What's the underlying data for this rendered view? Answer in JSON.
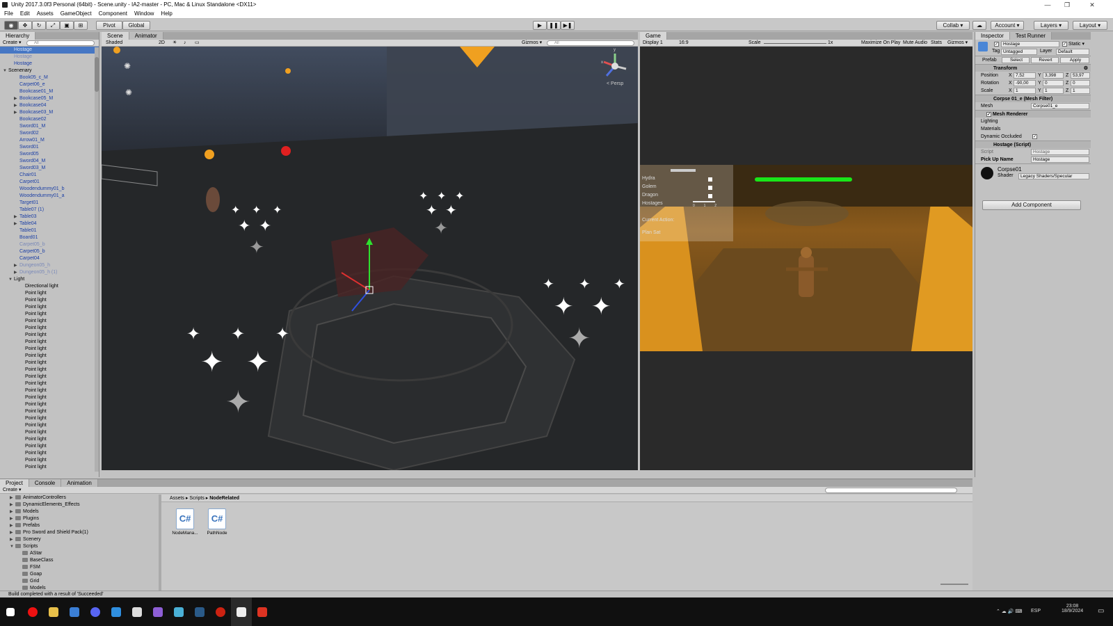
{
  "window": {
    "title": "Unity 2017.3.0f3 Personal (64bit) - Scene.unity - IA2-master - PC, Mac & Linux Standalone <DX11>",
    "minimize": "—",
    "maximize": "❐",
    "close": "✕"
  },
  "menu": [
    "File",
    "Edit",
    "Assets",
    "GameObject",
    "Component",
    "Window",
    "Help"
  ],
  "toolbar": {
    "pivot": "Pivot",
    "global": "Global",
    "play": "▶",
    "pause": "❚❚",
    "step": "▶❚",
    "collab": "Collab ▾",
    "cloud": "☁",
    "account": "Account ▾",
    "layers": "Layers ▾",
    "layout": "Layout ▾"
  },
  "hierarchy": {
    "tab": "Hierarchy",
    "create": "Create ▾",
    "search_placeholder": "All",
    "rows": [
      {
        "t": "Hostage",
        "d": 1,
        "c": "sel"
      },
      {
        "t": "Hostage",
        "d": 1,
        "c": "dim"
      },
      {
        "t": "Hostage",
        "d": 1,
        "c": "prefab"
      },
      {
        "t": "Scenenary",
        "d": 0,
        "c": "",
        "x": "▼"
      },
      {
        "t": "Book05_c_M",
        "d": 2,
        "c": "prefab"
      },
      {
        "t": "Carpet06_e",
        "d": 2,
        "c": "prefab"
      },
      {
        "t": "Bookcase01_M",
        "d": 2,
        "c": "prefab"
      },
      {
        "t": "Bookcase05_M",
        "d": 2,
        "c": "prefab",
        "x": "▶"
      },
      {
        "t": "Bookcase04",
        "d": 2,
        "c": "prefab",
        "x": "▶"
      },
      {
        "t": "Bookcase03_M",
        "d": 2,
        "c": "prefab",
        "x": "▶"
      },
      {
        "t": "Bookcase02",
        "d": 2,
        "c": "prefab"
      },
      {
        "t": "Sword01_M",
        "d": 2,
        "c": "prefab"
      },
      {
        "t": "Sword02",
        "d": 2,
        "c": "prefab"
      },
      {
        "t": "Arrow01_M",
        "d": 2,
        "c": "prefab"
      },
      {
        "t": "Sword01",
        "d": 2,
        "c": "prefab"
      },
      {
        "t": "Sword05",
        "d": 2,
        "c": "prefab"
      },
      {
        "t": "Sword04_M",
        "d": 2,
        "c": "prefab"
      },
      {
        "t": "Sword03_M",
        "d": 2,
        "c": "prefab"
      },
      {
        "t": "Chair01",
        "d": 2,
        "c": "prefab"
      },
      {
        "t": "Carpet01",
        "d": 2,
        "c": "prefab"
      },
      {
        "t": "Woodendummy01_b",
        "d": 2,
        "c": "prefab"
      },
      {
        "t": "Woodendummy01_a",
        "d": 2,
        "c": "prefab"
      },
      {
        "t": "Target01",
        "d": 2,
        "c": "prefab"
      },
      {
        "t": "Table07 (1)",
        "d": 2,
        "c": "prefab"
      },
      {
        "t": "Table03",
        "d": 2,
        "c": "prefab",
        "x": "▶"
      },
      {
        "t": "Table04",
        "d": 2,
        "c": "prefab",
        "x": "▶"
      },
      {
        "t": "Table01",
        "d": 2,
        "c": "prefab"
      },
      {
        "t": "Board01",
        "d": 2,
        "c": "prefab"
      },
      {
        "t": "Carpet05_b",
        "d": 2,
        "c": "dim"
      },
      {
        "t": "Carpet05_b",
        "d": 2,
        "c": "prefab"
      },
      {
        "t": "Carpet04",
        "d": 2,
        "c": "prefab"
      },
      {
        "t": "Dungeon05_h",
        "d": 2,
        "c": "dim",
        "x": "▶"
      },
      {
        "t": "Dungeon05_h (1)",
        "d": 2,
        "c": "dim",
        "x": "▶"
      },
      {
        "t": "Light",
        "d": 1,
        "c": "",
        "x": "▼"
      },
      {
        "t": "Directional light",
        "d": 3,
        "c": ""
      },
      {
        "t": "Point light",
        "d": 3,
        "c": ""
      },
      {
        "t": "Point light",
        "d": 3,
        "c": ""
      },
      {
        "t": "Point light",
        "d": 3,
        "c": ""
      },
      {
        "t": "Point light",
        "d": 3,
        "c": ""
      },
      {
        "t": "Point light",
        "d": 3,
        "c": ""
      },
      {
        "t": "Point light",
        "d": 3,
        "c": ""
      },
      {
        "t": "Point light",
        "d": 3,
        "c": ""
      },
      {
        "t": "Point light",
        "d": 3,
        "c": ""
      },
      {
        "t": "Point light",
        "d": 3,
        "c": ""
      },
      {
        "t": "Point light",
        "d": 3,
        "c": ""
      },
      {
        "t": "Point light",
        "d": 3,
        "c": ""
      },
      {
        "t": "Point light",
        "d": 3,
        "c": ""
      },
      {
        "t": "Point light",
        "d": 3,
        "c": ""
      },
      {
        "t": "Point light",
        "d": 3,
        "c": ""
      },
      {
        "t": "Point light",
        "d": 3,
        "c": ""
      },
      {
        "t": "Point light",
        "d": 3,
        "c": ""
      },
      {
        "t": "Point light",
        "d": 3,
        "c": ""
      },
      {
        "t": "Point light",
        "d": 3,
        "c": ""
      },
      {
        "t": "Point light",
        "d": 3,
        "c": ""
      },
      {
        "t": "Point light",
        "d": 3,
        "c": ""
      },
      {
        "t": "Point light",
        "d": 3,
        "c": ""
      },
      {
        "t": "Point light",
        "d": 3,
        "c": ""
      },
      {
        "t": "Point light",
        "d": 3,
        "c": ""
      },
      {
        "t": "Point light",
        "d": 3,
        "c": ""
      },
      {
        "t": "Point light",
        "d": 3,
        "c": ""
      },
      {
        "t": "Point light",
        "d": 3,
        "c": ""
      },
      {
        "t": "Point light",
        "d": 3,
        "c": ""
      }
    ]
  },
  "scene": {
    "tab_scene": "Scene",
    "tab_animator": "Animator",
    "shading": "Shaded",
    "mode_2d": "2D",
    "gizmos": "Gizmos ▾",
    "search_placeholder": "All",
    "persp": "< Persp",
    "axis_x": "x",
    "axis_y": "y"
  },
  "game": {
    "tab": "Game",
    "display": "Display 1",
    "aspect": "16:9",
    "scale_label": "Scale",
    "scale_value": "1x",
    "maximize": "Maximize On Play",
    "mute": "Mute Audio",
    "stats": "Stats",
    "gizmos": "Gizmos ▾",
    "hud": [
      "Hydra",
      "Golem",
      "Dragon",
      "Hostages",
      "Current Action:",
      "Plan Sat"
    ],
    "hud_ticks": [
      "0",
      "1",
      "2"
    ],
    "health_color": "#19e619"
  },
  "inspector": {
    "tab": "Inspector",
    "tab2": "Test Runner",
    "name": "Hostage",
    "static": "Static ▾",
    "tag_label": "Tag",
    "tag": "Untagged",
    "layer_label": "Layer",
    "layer": "Default",
    "prefab_label": "Prefab",
    "select": "Select",
    "revert": "Revert",
    "apply": "Apply",
    "transform": "Transform",
    "position": "Position",
    "rotation": "Rotation",
    "scale": "Scale",
    "pos": [
      "7,52",
      "3,398",
      "53,97"
    ],
    "rot": [
      "-90,00",
      "0",
      "0"
    ],
    "scl": [
      "1",
      "1",
      "1"
    ],
    "x": "X",
    "y": "Y",
    "z": "Z",
    "meshfilter": "Corpse 01_e (Mesh Filter)",
    "mesh_label": "Mesh",
    "mesh": "Corpse01_e",
    "meshrenderer": "Mesh Renderer",
    "lighting": "Lighting",
    "materials": "Materials",
    "dyn_occ": "Dynamic Occluded",
    "script_comp": "Hostage (Script)",
    "script_label": "Script",
    "script": "Hostage",
    "pickup_label": "Pick Up Name",
    "pickup": "Hostage",
    "material": "Corpse01",
    "shader_label": "Shader",
    "shader": "Legacy Shaders/Specular",
    "add_component": "Add Component"
  },
  "project": {
    "tab_project": "Project",
    "tab_console": "Console",
    "tab_animation": "Animation",
    "create": "Create ▾",
    "breadcrumb": [
      "Assets",
      "Scripts",
      "NodeRelated"
    ],
    "tree": [
      {
        "t": "AnimatorControllers",
        "d": 1,
        "x": "▶"
      },
      {
        "t": "DynamicElements_Effects",
        "d": 1,
        "x": "▶"
      },
      {
        "t": "Models",
        "d": 1,
        "x": "▶"
      },
      {
        "t": "Plugins",
        "d": 1,
        "x": "▶"
      },
      {
        "t": "Prefabs",
        "d": 1,
        "x": "▶"
      },
      {
        "t": "Pro Sword and Shield Pack(1)",
        "d": 1,
        "x": "▶"
      },
      {
        "t": "Scenery",
        "d": 1,
        "x": "▶"
      },
      {
        "t": "Scripts",
        "d": 1,
        "x": "▼"
      },
      {
        "t": "AStar",
        "d": 2,
        "x": ""
      },
      {
        "t": "BaseClass",
        "d": 2,
        "x": ""
      },
      {
        "t": "FSM",
        "d": 2,
        "x": ""
      },
      {
        "t": "Goap",
        "d": 2,
        "x": ""
      },
      {
        "t": "Grid",
        "d": 2,
        "x": ""
      },
      {
        "t": "Models",
        "d": 2,
        "x": ""
      },
      {
        "t": "NodeRelated",
        "d": 2,
        "x": "",
        "sel": true
      }
    ],
    "assets": [
      {
        "name": "NodeMana...",
        "icon": "C#"
      },
      {
        "name": "PathNode",
        "icon": "C#"
      }
    ]
  },
  "status": "Build completed with a result of 'Succeeded'",
  "taskbar": {
    "lang": "ESP",
    "time": "23:08",
    "date": "18/9/2024"
  }
}
